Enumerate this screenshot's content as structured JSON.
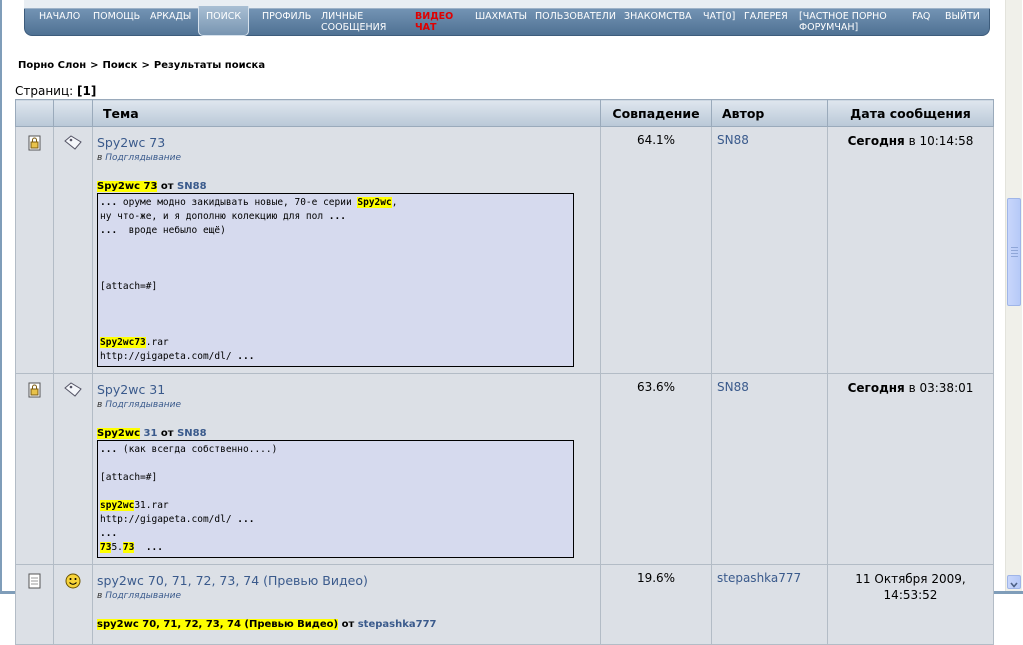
{
  "nav": {
    "items": [
      "НАЧАЛО",
      "ПОМОЩЬ",
      "АРКАДЫ",
      "ПОИСК",
      "ПРОФИЛЬ",
      "ЛИЧНЫЕ",
      "СООБЩЕНИЯ",
      "ВИДЕО",
      "ЧАТ",
      "ШАХМАТЫ",
      "ПОЛЬЗОВАТЕЛИ",
      "ЗНАКОМСТВА",
      "ЧАТ[0]",
      "ГАЛЕРЕЯ",
      "[ЧАСТНОЕ ПОРНО",
      "ФОРУМЧАН]",
      "FAQ",
      "ВЫЙТИ"
    ],
    "active": "ПОИСК"
  },
  "breadcrumb": [
    "Порно Слон",
    ">",
    "Поиск",
    ">",
    "Результаты поиска"
  ],
  "pages": {
    "label": "Страниц:",
    "current": "[1]"
  },
  "table": {
    "headers": [
      "Тема",
      "Совпадение",
      "Автор",
      "Дата сообщения"
    ],
    "rows": [
      {
        "topic": "Spy2wc 73",
        "in": "в",
        "forum": "Подглядывание",
        "post_title_hl": "Spy2wc 73",
        "from": "от",
        "post_author": "SN88",
        "quote": [
          "... оруме модно закидывать новые, 70-е серии Spy2wc,",
          "ну что-же, и я дополню колекцию для пол ...",
          "...  вроде небыло ещё)",
          "",
          "",
          "",
          "[attach=#]",
          "",
          "",
          "",
          "Spy2wc73.rar",
          "http://gigapeta.com/dl/ ..."
        ],
        "match": "64.1%",
        "author": "SN88",
        "date_bold": "Сегодня",
        "date_rest": "в 10:14:58"
      },
      {
        "topic": "Spy2wc 31",
        "in": "в",
        "forum": "Подглядывание",
        "post_title_hl": "Spy2wc",
        "post_title_rest": "31",
        "from": "от",
        "post_author": "SN88",
        "quote": [
          "... (как всегда собственно....)",
          "",
          "[attach=#]",
          "",
          "spy2wc31.rar",
          "http://gigapeta.com/dl/ ...",
          "...",
          "735.73  ..."
        ],
        "match": "63.6%",
        "author": "SN88",
        "date_bold": "Сегодня",
        "date_rest": "в 03:38:01"
      },
      {
        "topic": "spy2wc 70, 71, 72, 73, 74 (Превью Видео)",
        "in": "в",
        "forum": "Подглядывание",
        "post_title": "spy2wc 70, 71, 72, 73, 74 (Превью Видео)",
        "from": "от",
        "post_author": "stepashka777",
        "match": "19.6%",
        "author": "stepashka777",
        "date_line1": "11 Октября 2009,",
        "date_line2": "14:53:52"
      }
    ]
  },
  "colors": {
    "nav_bg": "#5f81a3",
    "highlight": "#ffff00",
    "link": "#3a5a8c",
    "cell_bg": "#dce0e6",
    "quote_bg": "#d6daee"
  },
  "icons": [
    "topic-file-locked-icon",
    "tag-icon",
    "topic-file-icon",
    "smiley-icon"
  ]
}
